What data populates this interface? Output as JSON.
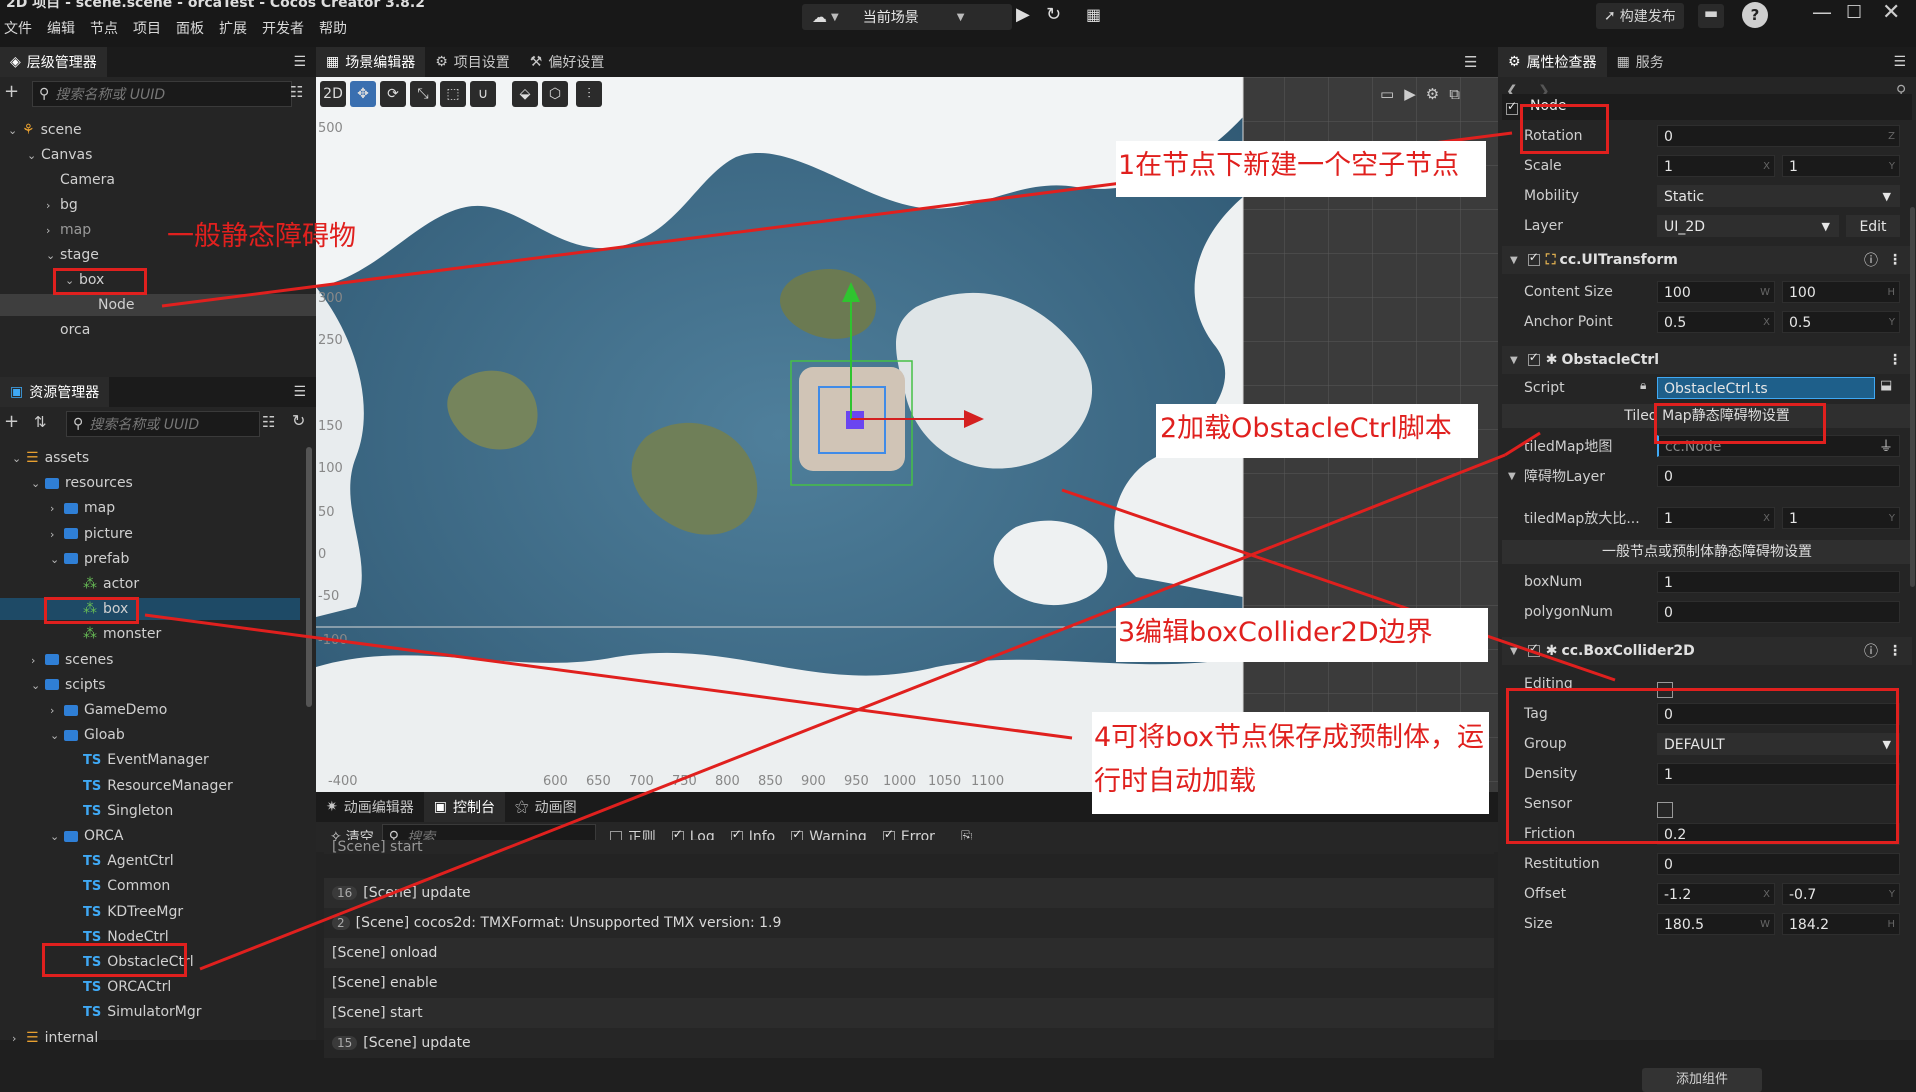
{
  "window": {
    "title": "2D 项目 - scene.scene - orcaTest - Cocos Creator 3.8.2",
    "scene_select": "当前场景",
    "publish_label": "构建发布"
  },
  "menu": [
    "文件",
    "编辑",
    "节点",
    "项目",
    "面板",
    "扩展",
    "开发者",
    "帮助"
  ],
  "hierarchy": {
    "tab": "层级管理器",
    "search_placeholder": "搜索名称或 UUID",
    "items": [
      {
        "label": "scene",
        "depth": 0,
        "arrow": "down",
        "dim": false
      },
      {
        "label": "Canvas",
        "depth": 1,
        "arrow": "down",
        "dim": false
      },
      {
        "label": "Camera",
        "depth": 2,
        "arrow": "",
        "dim": false
      },
      {
        "label": "bg",
        "depth": 2,
        "arrow": "right",
        "dim": false
      },
      {
        "label": "map",
        "depth": 2,
        "arrow": "right",
        "dim": true
      },
      {
        "label": "stage",
        "depth": 2,
        "arrow": "down",
        "dim": false
      },
      {
        "label": "box",
        "depth": 3,
        "arrow": "down",
        "dim": false
      },
      {
        "label": "Node",
        "depth": 4,
        "arrow": "",
        "dim": false
      },
      {
        "label": "orca",
        "depth": 2,
        "arrow": "",
        "dim": false
      }
    ]
  },
  "assets": {
    "tab": "资源管理器",
    "search_placeholder": "搜索名称或 UUID",
    "items": [
      {
        "label": "assets",
        "depth": 0,
        "arrow": "down",
        "kind": "db"
      },
      {
        "label": "resources",
        "depth": 1,
        "arrow": "down",
        "kind": "folder"
      },
      {
        "label": "map",
        "depth": 2,
        "arrow": "right",
        "kind": "folder"
      },
      {
        "label": "picture",
        "depth": 2,
        "arrow": "right",
        "kind": "folder"
      },
      {
        "label": "prefab",
        "depth": 2,
        "arrow": "down",
        "kind": "folder"
      },
      {
        "label": "actor",
        "depth": 3,
        "arrow": "",
        "kind": "prefab"
      },
      {
        "label": "box",
        "depth": 3,
        "arrow": "",
        "kind": "prefab"
      },
      {
        "label": "monster",
        "depth": 3,
        "arrow": "",
        "kind": "prefab"
      },
      {
        "label": "scenes",
        "depth": 1,
        "arrow": "right",
        "kind": "folder"
      },
      {
        "label": "scipts",
        "depth": 1,
        "arrow": "down",
        "kind": "folder"
      },
      {
        "label": "GameDemo",
        "depth": 2,
        "arrow": "right",
        "kind": "folder"
      },
      {
        "label": "Gloab",
        "depth": 2,
        "arrow": "down",
        "kind": "folder"
      },
      {
        "label": "EventManager",
        "depth": 3,
        "arrow": "",
        "kind": "ts"
      },
      {
        "label": "ResourceManager",
        "depth": 3,
        "arrow": "",
        "kind": "ts"
      },
      {
        "label": "Singleton",
        "depth": 3,
        "arrow": "",
        "kind": "ts"
      },
      {
        "label": "ORCA",
        "depth": 2,
        "arrow": "down",
        "kind": "folder"
      },
      {
        "label": "AgentCtrl",
        "depth": 3,
        "arrow": "",
        "kind": "ts"
      },
      {
        "label": "Common",
        "depth": 3,
        "arrow": "",
        "kind": "ts"
      },
      {
        "label": "KDTreeMgr",
        "depth": 3,
        "arrow": "",
        "kind": "ts"
      },
      {
        "label": "NodeCtrl",
        "depth": 3,
        "arrow": "",
        "kind": "ts"
      },
      {
        "label": "ObstacleCtrl",
        "depth": 3,
        "arrow": "",
        "kind": "ts"
      },
      {
        "label": "ORCACtrl",
        "depth": 3,
        "arrow": "",
        "kind": "ts"
      },
      {
        "label": "SimulatorMgr",
        "depth": 3,
        "arrow": "",
        "kind": "ts"
      },
      {
        "label": "internal",
        "depth": 0,
        "arrow": "right",
        "kind": "db"
      }
    ]
  },
  "scene_editor": {
    "tabs": [
      "场景编辑器",
      "项目设置",
      "偏好设置"
    ],
    "mode_2d": "2D",
    "y_ticks": [
      "500",
      "300",
      "250",
      "150",
      "100",
      "50",
      "0",
      "-50",
      "-100"
    ],
    "x_ticks": [
      "-400",
      "600",
      "650",
      "700",
      "750",
      "800",
      "850",
      "900",
      "950",
      "1000",
      "1050",
      "1100"
    ]
  },
  "console": {
    "tabs": [
      "动画编辑器",
      "控制台",
      "动画图"
    ],
    "clear": "清空",
    "search_placeholder": "搜索",
    "filters": [
      {
        "label": "正则",
        "checked": false
      },
      {
        "label": "Log",
        "checked": true
      },
      {
        "label": "Info",
        "checked": true
      },
      {
        "label": "Warning",
        "checked": true
      },
      {
        "label": "Error",
        "checked": true
      }
    ],
    "rows": [
      {
        "count": "",
        "text": "[Scene] start"
      },
      {
        "count": "16",
        "text": "[Scene] update"
      },
      {
        "count": "2",
        "text": "[Scene] cocos2d: TMXFormat: Unsupported TMX version: 1.9"
      },
      {
        "count": "",
        "text": "[Scene] onload"
      },
      {
        "count": "",
        "text": "[Scene] enable"
      },
      {
        "count": "",
        "text": "[Scene] start"
      },
      {
        "count": "15",
        "text": "[Scene] update"
      }
    ]
  },
  "inspector": {
    "tabs": [
      "属性检查器",
      "服务"
    ],
    "node_name": "Node",
    "rotation": {
      "label": "Rotation",
      "value": "0",
      "unit": "Z"
    },
    "scale": {
      "label": "Scale",
      "x": "1",
      "y": "1"
    },
    "mobility": {
      "label": "Mobility",
      "value": "Static"
    },
    "layer": {
      "label": "Layer",
      "value": "UI_2D",
      "edit": "Edit"
    },
    "uitransform": {
      "title": "cc.UITransform",
      "content_size_label": "Content Size",
      "w": "100",
      "h": "100",
      "anchor_label": "Anchor Point",
      "ax": "0.5",
      "ay": "0.5"
    },
    "obstacle": {
      "title": "ObstacleCtrl",
      "script_label": "Script",
      "script_value": "ObstacleCtrl.ts",
      "tiled_header": "Tiled Map静态障碍物设置",
      "tiled_map_label": "tiledMap地图",
      "tiled_map_value": "cc.Node",
      "layer_label": "障碍物Layer",
      "layer_value": "0",
      "scale_label": "tiledMap放大比...",
      "scale_x": "1",
      "scale_y": "1",
      "general_header": "一般节点或预制体静态障碍物设置",
      "boxnum_label": "boxNum",
      "boxnum_value": "1",
      "polynum_label": "polygonNum",
      "polynum_value": "0"
    },
    "collider": {
      "title": "cc.BoxCollider2D",
      "editing_label": "Editing",
      "tag_label": "Tag",
      "tag_value": "0",
      "group_label": "Group",
      "group_value": "DEFAULT",
      "density_label": "Density",
      "density_value": "1",
      "sensor_label": "Sensor",
      "friction_label": "Friction",
      "friction_value": "0.2",
      "restitution_label": "Restitution",
      "restitution_value": "0",
      "offset_label": "Offset",
      "offset_x": "-1.2",
      "offset_y": "-0.7",
      "size_label": "Size",
      "size_w": "180.5",
      "size_h": "184.2"
    },
    "add_component": "添加组件"
  },
  "annotations": {
    "a0": "一般静态障碍物",
    "a1": "1在节点下新建一个空子节点",
    "a2": "2加载ObstacleCtrl脚本",
    "a3": "3编辑boxCollider2D边界",
    "a4_line1": "4可将box节点保存成预制体，运",
    "a4_line2": "行时自动加载"
  }
}
